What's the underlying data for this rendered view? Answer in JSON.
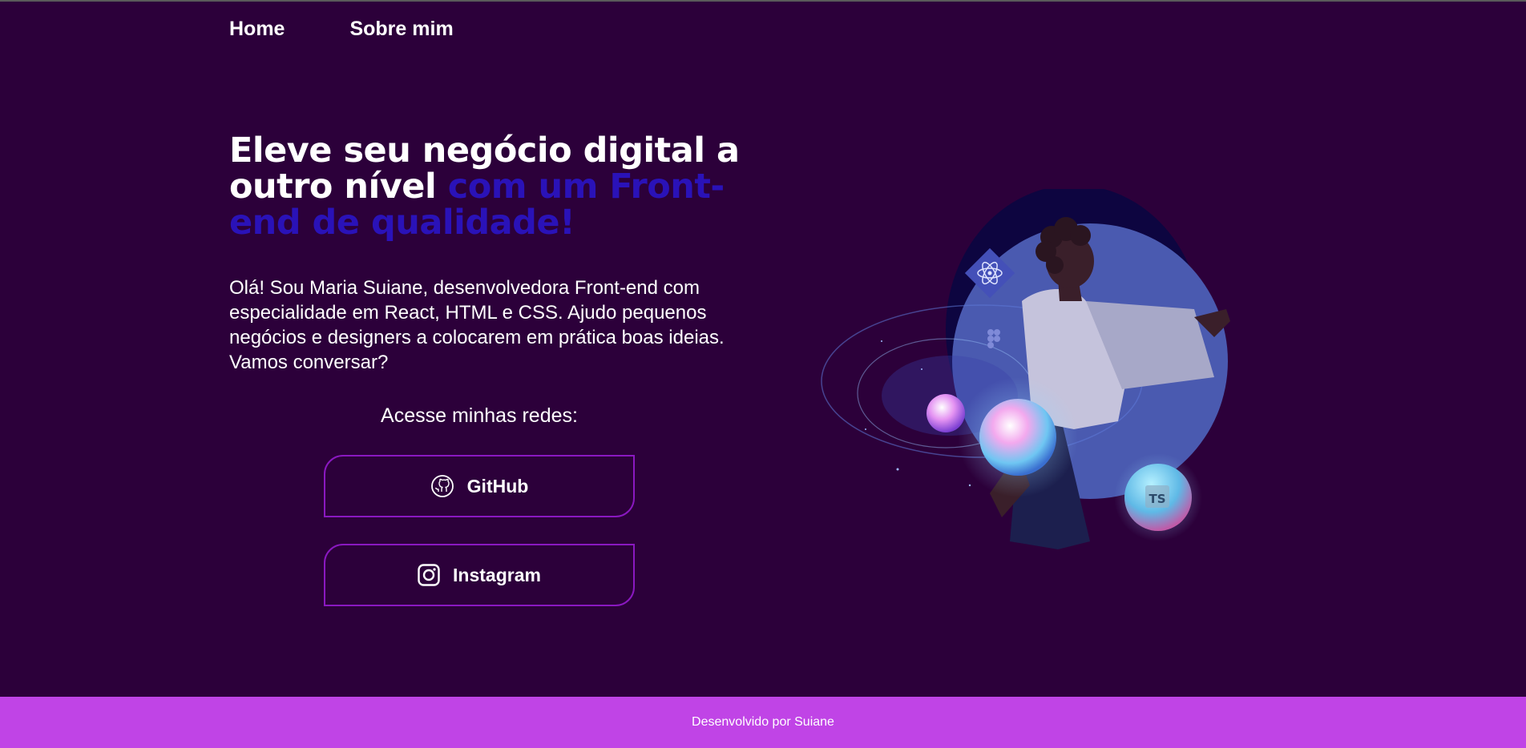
{
  "nav": {
    "items": [
      {
        "label": "Home"
      },
      {
        "label": "Sobre mim"
      }
    ]
  },
  "hero": {
    "title_part1": "Eleve seu negócio digital a outro nível",
    "title_part2": "com um Front-end de qualidade!",
    "intro": "Olá! Sou Maria Suiane, desenvolvedora Front-end com especialidade em React, HTML e CSS. Ajudo pequenos negócios e designers a colocarem em prática boas ideias. Vamos conversar?"
  },
  "networks": {
    "label": "Acesse minhas redes:",
    "github": {
      "label": "GitHub",
      "icon": "github-icon"
    },
    "instagram": {
      "label": "Instagram",
      "icon": "instagram-icon"
    }
  },
  "illustration": {
    "badge_ts": "TS"
  },
  "footer": {
    "text": "Desenvolvido por Suiane"
  },
  "colors": {
    "background": "#2c003a",
    "accent_text": "#2a12b8",
    "button_border": "#8a18c0",
    "footer_bg": "#c044e6"
  }
}
